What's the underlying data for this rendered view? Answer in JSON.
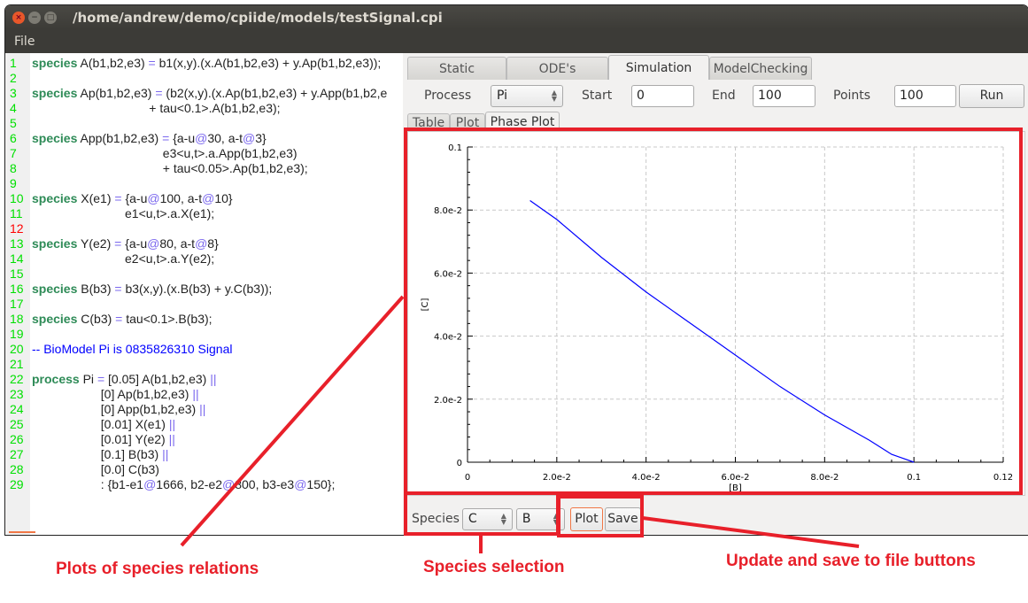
{
  "window": {
    "title": "/home/andrew/demo/cpiide/models/testSignal.cpi",
    "menu": [
      "File"
    ]
  },
  "editor": {
    "error_line": 12,
    "lines": [
      [
        [
          "kw",
          "species"
        ],
        [
          "n",
          " A(b1,b2,e3) "
        ],
        [
          "op",
          "="
        ],
        [
          "n",
          " b1(x,y).(x.A(b1,b2,e3) + y.Ap(b1,b2,e3));"
        ]
      ],
      [],
      [
        [
          "kw",
          "species"
        ],
        [
          "n",
          " Ap(b1,b2,e3) "
        ],
        [
          "op",
          "="
        ],
        [
          "n",
          " (b2(x,y).(x.Ap(b1,b2,e3) + y.App(b1,b2,e"
        ]
      ],
      [
        [
          "n",
          "                                  + tau<0.1>.A(b1,b2,e3);"
        ]
      ],
      [],
      [
        [
          "kw",
          "species"
        ],
        [
          "n",
          " App(b1,b2,e3) "
        ],
        [
          "op",
          "="
        ],
        [
          "n",
          " {a-u"
        ],
        [
          "at",
          "@"
        ],
        [
          "n",
          "30, a-t"
        ],
        [
          "at",
          "@"
        ],
        [
          "n",
          "3}"
        ]
      ],
      [
        [
          "n",
          "                                      e3<u,t>.a.App(b1,b2,e3)"
        ]
      ],
      [
        [
          "n",
          "                                      + tau<0.05>.Ap(b1,b2,e3);"
        ]
      ],
      [],
      [
        [
          "kw",
          "species"
        ],
        [
          "n",
          " X(e1) "
        ],
        [
          "op",
          "="
        ],
        [
          "n",
          " {a-u"
        ],
        [
          "at",
          "@"
        ],
        [
          "n",
          "100, a-t"
        ],
        [
          "at",
          "@"
        ],
        [
          "n",
          "10}"
        ]
      ],
      [
        [
          "n",
          "                           e1<u,t>.a.X(e1);"
        ]
      ],
      [],
      [
        [
          "kw",
          "species"
        ],
        [
          "n",
          " Y(e2) "
        ],
        [
          "op",
          "="
        ],
        [
          "n",
          " {a-u"
        ],
        [
          "at",
          "@"
        ],
        [
          "n",
          "80, a-t"
        ],
        [
          "at",
          "@"
        ],
        [
          "n",
          "8}"
        ]
      ],
      [
        [
          "n",
          "                           e2<u,t>.a.Y(e2);"
        ]
      ],
      [],
      [
        [
          "kw",
          "species"
        ],
        [
          "n",
          " B(b3) "
        ],
        [
          "op",
          "="
        ],
        [
          "n",
          " b3(x,y).(x.B(b3) + y.C(b3));"
        ]
      ],
      [],
      [
        [
          "kw",
          "species"
        ],
        [
          "n",
          " C(b3) "
        ],
        [
          "op",
          "="
        ],
        [
          "n",
          " tau<0.1>.B(b3);"
        ]
      ],
      [],
      [
        [
          "cm",
          "-- BioModel Pi is 0835826310 Signal"
        ]
      ],
      [],
      [
        [
          "kw",
          "process"
        ],
        [
          "n",
          " Pi "
        ],
        [
          "op",
          "="
        ],
        [
          "n",
          " [0.05] A(b1,b2,e3) "
        ],
        [
          "op",
          "||"
        ]
      ],
      [
        [
          "n",
          "                    [0] Ap(b1,b2,e3) "
        ],
        [
          "op",
          "||"
        ]
      ],
      [
        [
          "n",
          "                    [0] App(b1,b2,e3) "
        ],
        [
          "op",
          "||"
        ]
      ],
      [
        [
          "n",
          "                    [0.01] X(e1) "
        ],
        [
          "op",
          "||"
        ]
      ],
      [
        [
          "n",
          "                    [0.01] Y(e2) "
        ],
        [
          "op",
          "||"
        ]
      ],
      [
        [
          "n",
          "                    [0.1] B(b3) "
        ],
        [
          "op",
          "||"
        ]
      ],
      [
        [
          "n",
          "                    [0.0] C(b3)"
        ]
      ],
      [
        [
          "n",
          "                    : {b1-e1"
        ],
        [
          "at",
          "@"
        ],
        [
          "n",
          "1666, b2-e2"
        ],
        [
          "at",
          "@"
        ],
        [
          "n",
          "800, b3-e3"
        ],
        [
          "at",
          "@"
        ],
        [
          "n",
          "150};"
        ]
      ]
    ]
  },
  "tabs": [
    {
      "label": "Static"
    },
    {
      "label": "ODE's"
    },
    {
      "label": "Simulation",
      "active": true
    },
    {
      "label": "ModelChecking"
    }
  ],
  "controls": {
    "process_label": "Process",
    "process_value": "Pi",
    "start_label": "Start",
    "start_value": "0",
    "end_label": "End",
    "end_value": "100",
    "points_label": "Points",
    "points_value": "100",
    "run_label": "Run"
  },
  "subtabs": [
    {
      "label": "Table"
    },
    {
      "label": "Plot"
    },
    {
      "label": "Phase Plot",
      "active": true
    }
  ],
  "bottom": {
    "species_label": "Species",
    "species_y": "C",
    "species_x": "B",
    "plot_label": "Plot",
    "save_label": "Save"
  },
  "annotations": {
    "plots": "Plots of species relations",
    "selection": "Species selection",
    "buttons": "Update and save to file buttons",
    "color": "#e8202a"
  },
  "chart_data": {
    "type": "line",
    "xlabel": "[B]",
    "ylabel": "[C]",
    "xlim": [
      0,
      0.12
    ],
    "ylim": [
      0,
      0.1
    ],
    "xticks": [
      "0",
      "2.0e-2",
      "4.0e-2",
      "6.0e-2",
      "8.0e-2",
      "0.1",
      "0.12"
    ],
    "yticks": [
      "0",
      "2.0e-2",
      "4.0e-2",
      "6.0e-2",
      "8.0e-2",
      "0.1"
    ],
    "grid": true,
    "line_color": "#0000ff",
    "x": [
      0.014,
      0.02,
      0.03,
      0.04,
      0.05,
      0.06,
      0.07,
      0.08,
      0.09,
      0.095,
      0.1
    ],
    "y": [
      0.083,
      0.077,
      0.065,
      0.054,
      0.044,
      0.034,
      0.024,
      0.015,
      0.007,
      0.0025,
      0
    ]
  }
}
